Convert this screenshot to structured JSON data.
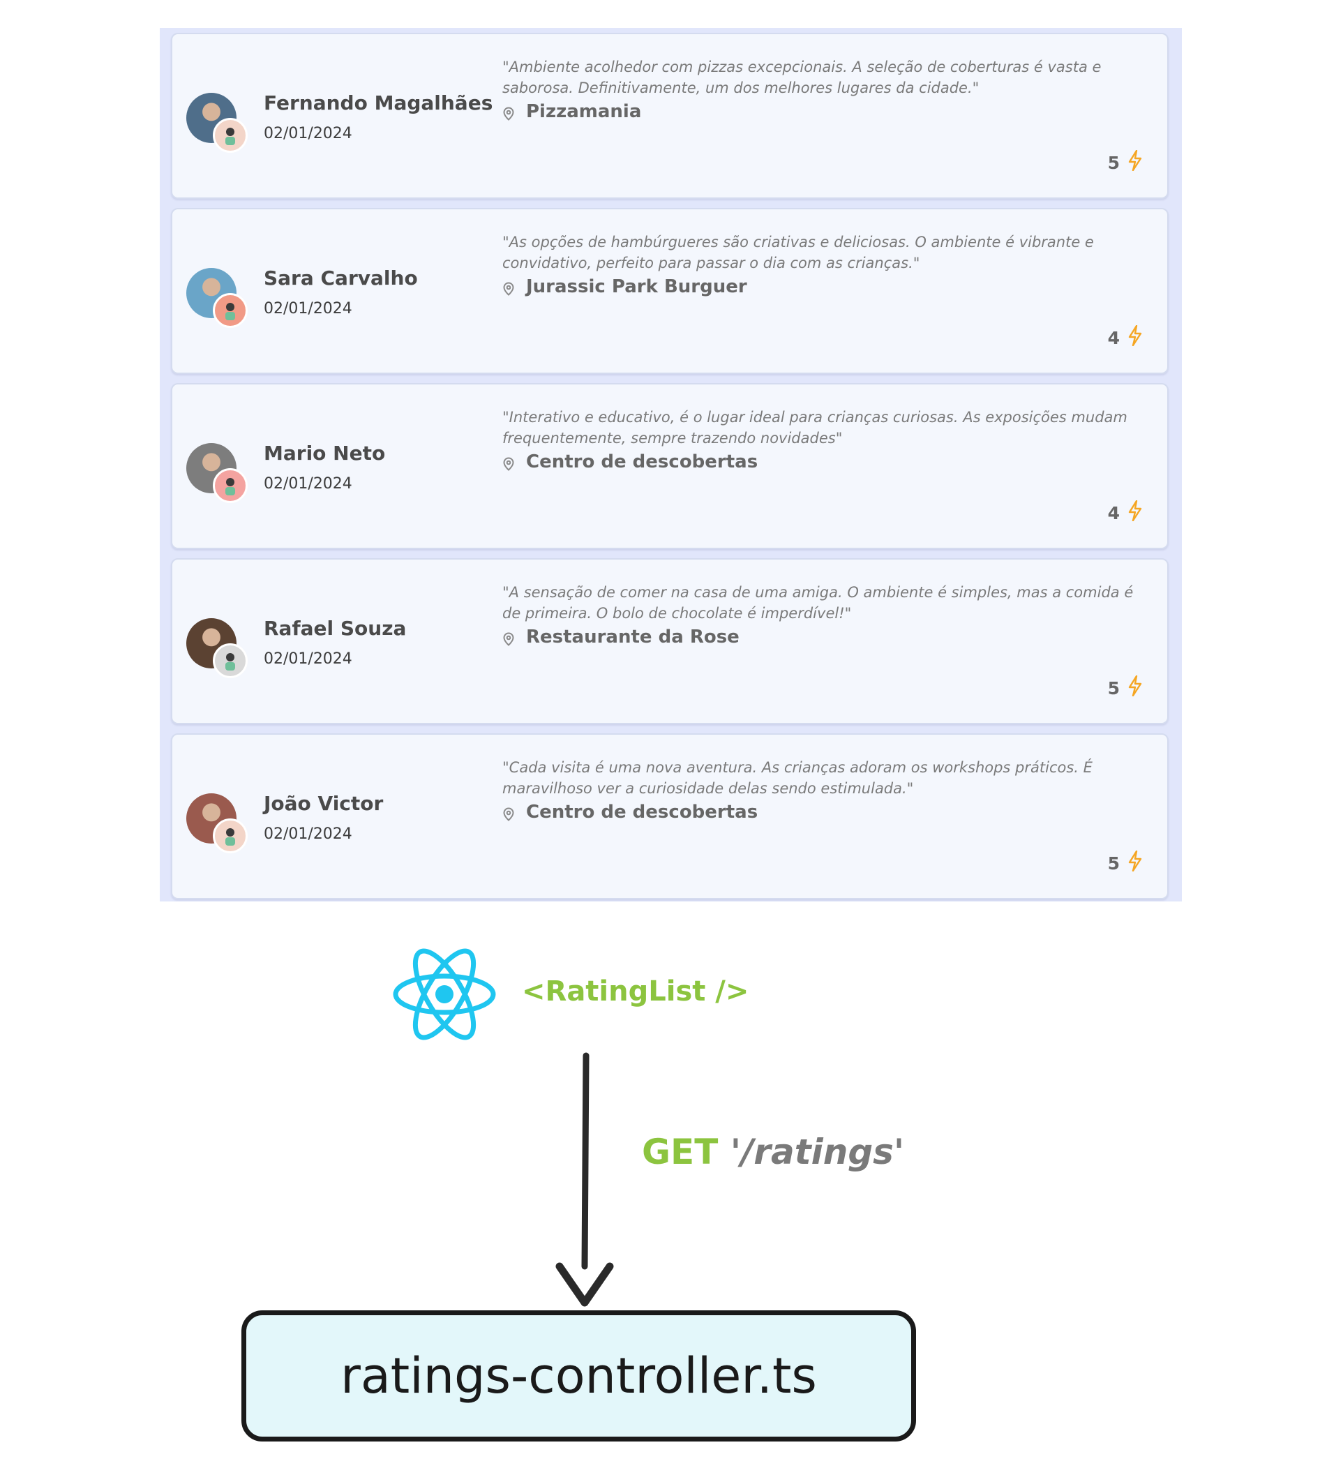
{
  "ratings": [
    {
      "name": "Fernando Magalhães",
      "date": "02/01/2024",
      "quote": "\"Ambiente acolhedor com pizzas excepcionais. A seleção de coberturas é vasta e saborosa. Definitivamente, um dos melhores lugares da cidade.\"",
      "place": "Pizzamania",
      "score": "5",
      "avatar_color": "#4f6e8a",
      "badge_color": "#f3d5c8"
    },
    {
      "name": "Sara Carvalho",
      "date": "02/01/2024",
      "quote": "\"As opções de hambúrgueres são criativas e deliciosas. O ambiente é vibrante e convidativo, perfeito para passar o dia com as crianças.\"",
      "place": "Jurassic Park Burguer",
      "score": "4",
      "avatar_color": "#6aa5c8",
      "badge_color": "#f19a86"
    },
    {
      "name": "Mario Neto",
      "date": "02/01/2024",
      "quote": "\"Interativo e educativo, é o lugar ideal para crianças curiosas. As exposições mudam frequentemente, sempre trazendo novidades\"",
      "place": "Centro de descobertas",
      "score": "4",
      "avatar_color": "#7d7d7d",
      "badge_color": "#f4a3a0"
    },
    {
      "name": "Rafael Souza",
      "date": "02/01/2024",
      "quote": "\"A sensação de comer na casa de uma amiga. O ambiente é simples, mas a comida é de primeira. O bolo de chocolate é imperdível!\"",
      "place": "Restaurante da Rose",
      "score": "5",
      "avatar_color": "#5b4232",
      "badge_color": "#d9d9d9"
    },
    {
      "name": "João Victor",
      "date": "02/01/2024",
      "quote": "\"Cada visita é uma nova aventura. As crianças adoram os workshops práticos. É maravilhoso ver a curiosidade delas sendo estimulada.\"",
      "place": "Centro de descobertas",
      "score": "5",
      "avatar_color": "#9a5a4e",
      "badge_color": "#f3d5c8"
    }
  ],
  "diagram": {
    "component_label": "<RatingList />",
    "request_method": "GET",
    "request_path": "'/ratings'",
    "controller_file": "ratings-controller.ts"
  },
  "colors": {
    "accent_green": "#8cc43f",
    "react_blue": "#1fc6f0",
    "bolt_orange": "#f5a623",
    "panel_bg": "#e1e6fb",
    "card_bg": "#f4f7fd",
    "controller_bg": "#e3f7fa"
  },
  "icons": {
    "rating": "bolt-icon",
    "place": "location-pin-icon",
    "framework": "react-logo-icon"
  }
}
